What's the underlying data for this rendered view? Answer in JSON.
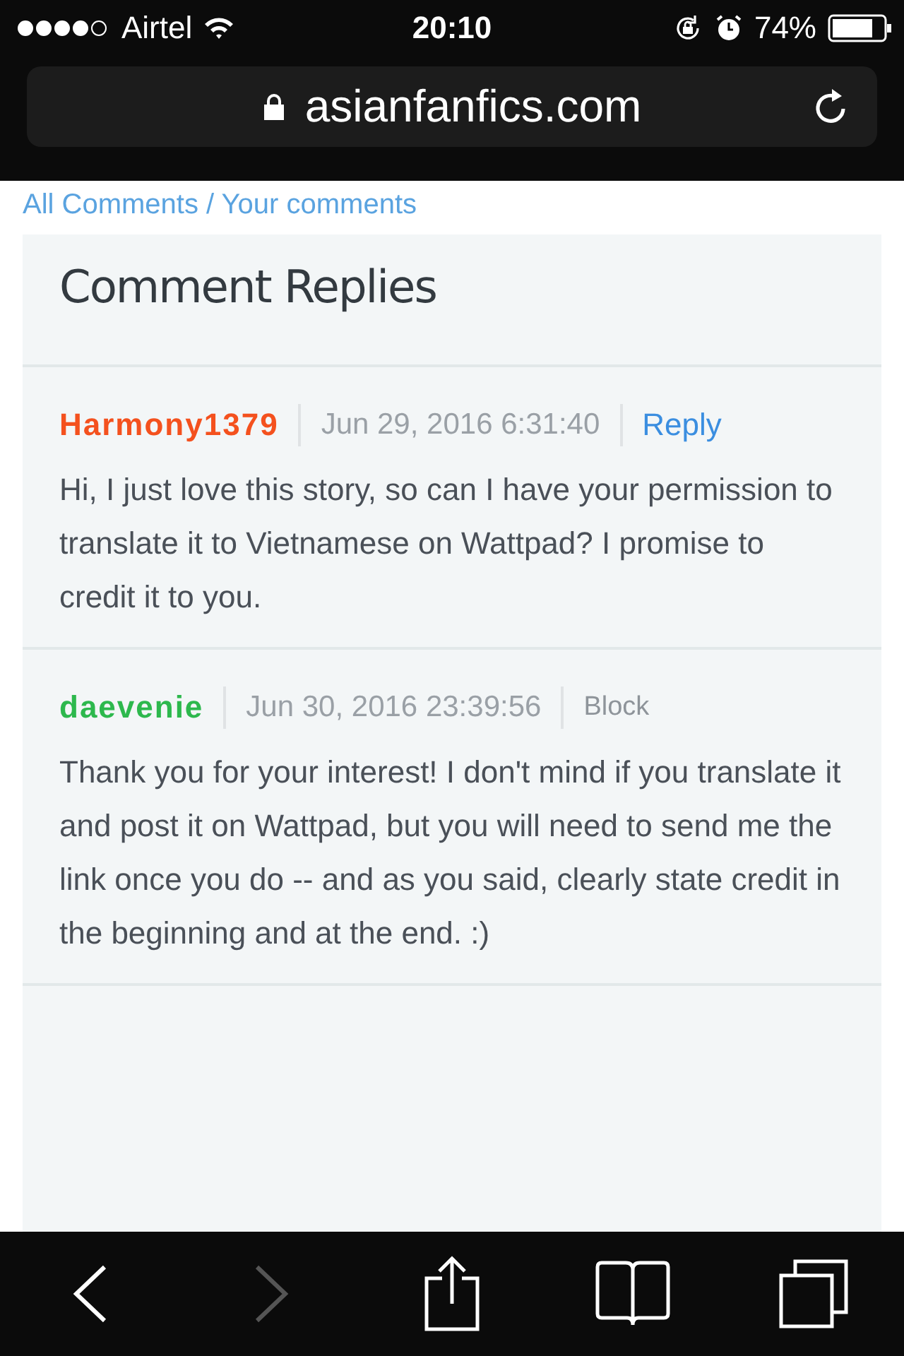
{
  "status_bar": {
    "carrier": "Airtel",
    "time": "20:10",
    "battery": "74%"
  },
  "address_bar": {
    "url": "asianfanfics.com"
  },
  "breadcrumb": "All Comments / Your comments",
  "section_title": "Comment Replies",
  "comments": [
    {
      "author": "Harmony1379",
      "color": "#f4511e",
      "date": "Jun 29, 2016 6:31:40",
      "action": {
        "kind": "reply",
        "label": "Reply"
      },
      "text": "Hi, I just love this story, so can I have your permission to translate it to Vietnamese on Wattpad? I promise to credit it to you."
    },
    {
      "author": "daevenie",
      "color": "#2db84d",
      "date": "Jun 30, 2016 23:39:56",
      "action": {
        "kind": "block",
        "label": "Block"
      },
      "text": "Thank you for your interest! I don't mind if you translate it and post it on Wattpad, but you will need to send me the link once you do -- and as you said, clearly state credit in the beginning and at the end. :)"
    }
  ],
  "toolbar": [
    {
      "kind": "back",
      "disabled": false
    },
    {
      "kind": "forward",
      "disabled": true
    },
    {
      "kind": "share",
      "disabled": false
    },
    {
      "kind": "bookmarks",
      "disabled": false
    },
    {
      "kind": "tabs",
      "disabled": false
    }
  ]
}
